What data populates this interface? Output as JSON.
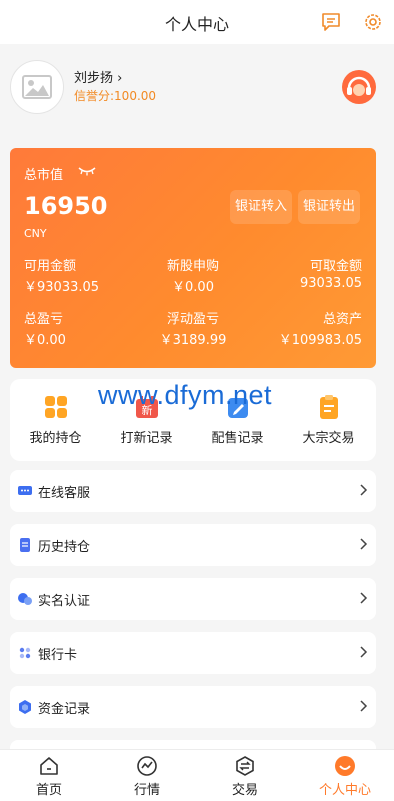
{
  "header": {
    "title": "个人中心",
    "message_icon": "message-icon",
    "settings_icon": "gear-icon"
  },
  "profile": {
    "name": "刘步扬",
    "credit": "信誉分:100.00"
  },
  "assets": {
    "total_label": "总市值",
    "total_value": "16950",
    "currency": "CNY",
    "transfer_in": "银证转入",
    "transfer_out": "银证转出",
    "available_label": "可用金额",
    "available_value": "￥93033.05",
    "ipo_label": "新股申购",
    "ipo_value": "￥0.00",
    "withdrawable_label": "可取金额",
    "withdrawable_value": "93033.05",
    "pnl_label": "总盈亏",
    "pnl_value": "￥0.00",
    "floating_label": "浮动盈亏",
    "floating_value": "￥3189.99",
    "total_assets_label": "总资产",
    "total_assets_value": "￥109983.05"
  },
  "quick_actions": [
    {
      "label": "我的持仓",
      "icon": "grid-icon"
    },
    {
      "label": "打新记录",
      "icon": "new-stock-icon"
    },
    {
      "label": "配售记录",
      "icon": "edit-doc-icon"
    },
    {
      "label": "大宗交易",
      "icon": "clipboard-icon"
    }
  ],
  "watermark": "www.dfym.net",
  "menu": [
    {
      "label": "在线客服",
      "icon": "chat-icon"
    },
    {
      "label": "历史持仓",
      "icon": "document-icon"
    },
    {
      "label": "实名认证",
      "icon": "id-icon"
    },
    {
      "label": "银行卡",
      "icon": "card-icon"
    },
    {
      "label": "资金记录",
      "icon": "fund-icon"
    }
  ],
  "tabs": [
    {
      "label": "首页",
      "icon": "home-icon"
    },
    {
      "label": "行情",
      "icon": "market-icon"
    },
    {
      "label": "交易",
      "icon": "trade-icon"
    },
    {
      "label": "个人中心",
      "icon": "profile-icon"
    }
  ],
  "colors": {
    "accent": "#ff7a2a",
    "credit": "#f28a24",
    "watermark": "#1a6bd6"
  }
}
